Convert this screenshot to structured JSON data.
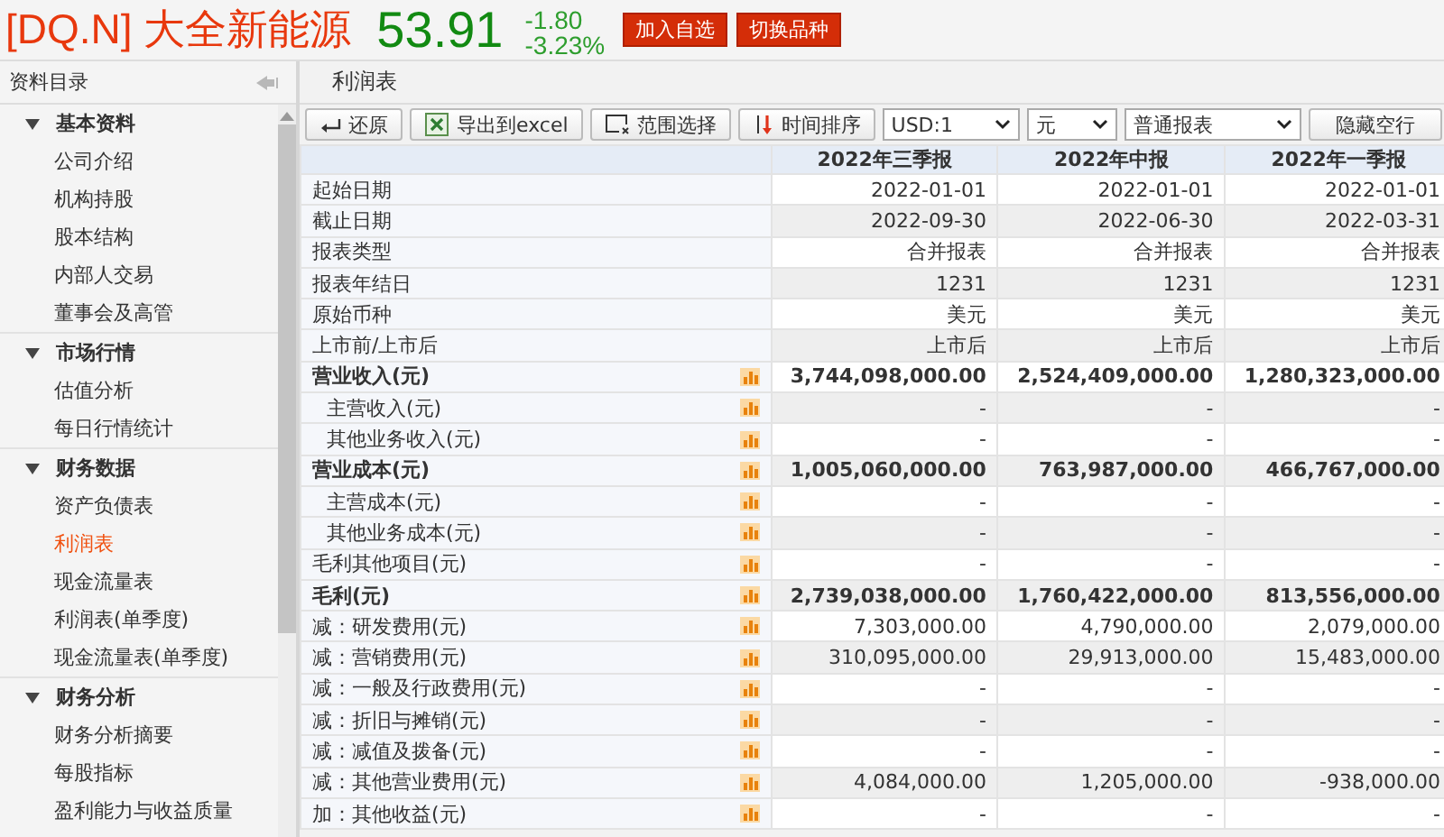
{
  "header": {
    "title": "[DQ.N] 大全新能源",
    "price": "53.91",
    "change": "-1.80",
    "change_pct": "-3.23%",
    "buttons": [
      "加入自选",
      "切换品种"
    ]
  },
  "sidebar": {
    "title": "资料目录",
    "groups": [
      {
        "label": "基本资料",
        "expanded": true,
        "items": [
          {
            "label": "公司介绍",
            "selected": false
          },
          {
            "label": "机构持股",
            "selected": false
          },
          {
            "label": "股本结构",
            "selected": false
          },
          {
            "label": "内部人交易",
            "selected": false
          },
          {
            "label": "董事会及高管",
            "selected": false
          }
        ]
      },
      {
        "label": "市场行情",
        "expanded": true,
        "items": [
          {
            "label": "估值分析",
            "selected": false
          },
          {
            "label": "每日行情统计",
            "selected": false
          }
        ]
      },
      {
        "label": "财务数据",
        "expanded": true,
        "items": [
          {
            "label": "资产负债表",
            "selected": false
          },
          {
            "label": "利润表",
            "selected": true
          },
          {
            "label": "现金流量表",
            "selected": false
          },
          {
            "label": "利润表(单季度)",
            "selected": false
          },
          {
            "label": "现金流量表(单季度)",
            "selected": false
          }
        ]
      },
      {
        "label": "财务分析",
        "expanded": true,
        "items": [
          {
            "label": "财务分析摘要",
            "selected": false
          },
          {
            "label": "每股指标",
            "selected": false
          },
          {
            "label": "盈利能力与收益质量",
            "selected": false
          }
        ]
      }
    ]
  },
  "panel": {
    "title": "利润表",
    "toolbar": [
      {
        "kind": "restore",
        "label": "还原"
      },
      {
        "kind": "export",
        "label": "导出到excel"
      },
      {
        "kind": "range",
        "label": "范围选择"
      },
      {
        "kind": "sort",
        "label": "时间排序"
      },
      {
        "kind": "select",
        "label": "USD:1"
      },
      {
        "kind": "select",
        "label": "元"
      },
      {
        "kind": "select",
        "label": "普通报表"
      },
      {
        "kind": "plain",
        "label": "隐藏空行"
      }
    ],
    "table": {
      "columns": [
        "2022年三季报",
        "2022年中报",
        "2022年一季报"
      ],
      "rows": [
        {
          "label": "起始日期",
          "kind": "plain",
          "chart": false,
          "values": [
            "2022-01-01",
            "2022-01-01",
            "2022-01-01"
          ]
        },
        {
          "label": "截止日期",
          "kind": "plain",
          "chart": false,
          "values": [
            "2022-09-30",
            "2022-06-30",
            "2022-03-31"
          ]
        },
        {
          "label": "报表类型",
          "kind": "plain",
          "chart": false,
          "values": [
            "合并报表",
            "合并报表",
            "合并报表"
          ]
        },
        {
          "label": "报表年结日",
          "kind": "plain",
          "chart": false,
          "values": [
            "1231",
            "1231",
            "1231"
          ]
        },
        {
          "label": "原始币种",
          "kind": "plain",
          "chart": false,
          "values": [
            "美元",
            "美元",
            "美元"
          ]
        },
        {
          "label": "上市前/上市后",
          "kind": "plain",
          "chart": false,
          "values": [
            "上市后",
            "上市后",
            "上市后"
          ]
        },
        {
          "label": "营业收入(元)",
          "kind": "bold",
          "chart": true,
          "values": [
            "3,744,098,000.00",
            "2,524,409,000.00",
            "1,280,323,000.00"
          ]
        },
        {
          "label": "主营收入(元)",
          "kind": "sub",
          "chart": true,
          "values": [
            "-",
            "-",
            "-"
          ]
        },
        {
          "label": "其他业务收入(元)",
          "kind": "sub",
          "chart": true,
          "values": [
            "-",
            "-",
            "-"
          ]
        },
        {
          "label": "营业成本(元)",
          "kind": "bold",
          "chart": true,
          "values": [
            "1,005,060,000.00",
            "763,987,000.00",
            "466,767,000.00"
          ]
        },
        {
          "label": "主营成本(元)",
          "kind": "sub",
          "chart": true,
          "values": [
            "-",
            "-",
            "-"
          ]
        },
        {
          "label": "其他业务成本(元)",
          "kind": "sub",
          "chart": true,
          "values": [
            "-",
            "-",
            "-"
          ]
        },
        {
          "label": "毛利其他项目(元)",
          "kind": "plain",
          "chart": true,
          "values": [
            "-",
            "-",
            "-"
          ]
        },
        {
          "label": "毛利(元)",
          "kind": "bold",
          "chart": true,
          "values": [
            "2,739,038,000.00",
            "1,760,422,000.00",
            "813,556,000.00"
          ]
        },
        {
          "label": "减：研发费用(元)",
          "kind": "plain",
          "chart": true,
          "values": [
            "7,303,000.00",
            "4,790,000.00",
            "2,079,000.00"
          ]
        },
        {
          "label": "减：营销费用(元)",
          "kind": "plain",
          "chart": true,
          "values": [
            "310,095,000.00",
            "29,913,000.00",
            "15,483,000.00"
          ]
        },
        {
          "label": "减：一般及行政费用(元)",
          "kind": "plain",
          "chart": true,
          "values": [
            "-",
            "-",
            "-"
          ]
        },
        {
          "label": "减：折旧与摊销(元)",
          "kind": "plain",
          "chart": true,
          "values": [
            "-",
            "-",
            "-"
          ]
        },
        {
          "label": "减：减值及拨备(元)",
          "kind": "plain",
          "chart": true,
          "values": [
            "-",
            "-",
            "-"
          ]
        },
        {
          "label": "减：其他营业费用(元)",
          "kind": "plain",
          "chart": true,
          "values": [
            "4,084,000.00",
            "1,205,000.00",
            "-938,000.00"
          ]
        },
        {
          "label": "加：其他收益(元)",
          "kind": "plain",
          "chart": true,
          "values": [
            "-",
            "-",
            "-"
          ]
        }
      ]
    }
  }
}
